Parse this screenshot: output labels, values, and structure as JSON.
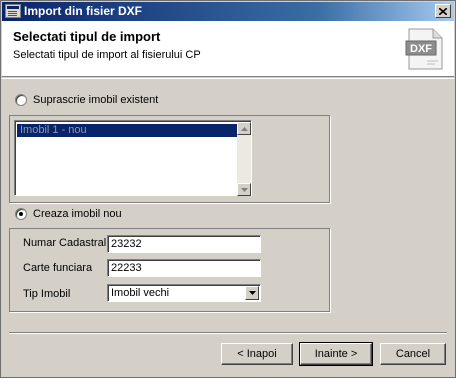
{
  "window": {
    "title": "Import din fisier DXF"
  },
  "header": {
    "title": "Selectati tipul de import",
    "subtitle": "Selectati tipul de import al fisierului CP",
    "icon_text": "DXF"
  },
  "option_overwrite": {
    "label": "Suprascrie imobil existent",
    "checked": false,
    "list_items": [
      "Imobil 1 - nou"
    ]
  },
  "option_create": {
    "label": "Creaza imobil nou",
    "checked": true
  },
  "fields": {
    "numar_cadastral": {
      "label": "Numar Cadastral",
      "value": "23232"
    },
    "carte_funciara": {
      "label": "Carte funciara",
      "value": "22233"
    },
    "tip_imobil": {
      "label": "Tip Imobil",
      "value": "Imobil vechi"
    }
  },
  "buttons": {
    "back": "< Inapoi",
    "next": "Inainte >",
    "cancel": "Cancel"
  },
  "colors": {
    "title_active": "#0a246a",
    "face": "#d4d0c8",
    "selection": "#0a246a"
  }
}
